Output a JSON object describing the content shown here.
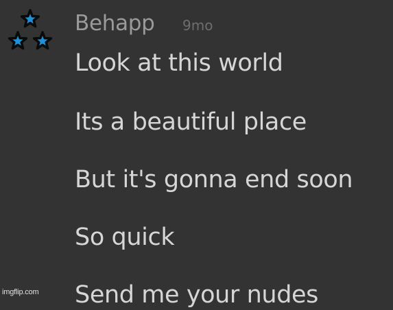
{
  "comment": {
    "username": "Behapp",
    "timestamp": "9mo",
    "lines": [
      "Look at this world",
      "Its a beautiful place",
      "But it's gonna end soon",
      "So quick",
      "Send me your nudes"
    ]
  },
  "watermark": "imgflip.com",
  "colors": {
    "background": "#333333",
    "username": "#9a9a9a",
    "timestamp": "#6e6e6e",
    "text": "#d6d6d6",
    "star_fill": "#1e90d8",
    "star_outline": "#0a0a0a"
  },
  "icons": {
    "avatar": "three-stars-icon"
  }
}
